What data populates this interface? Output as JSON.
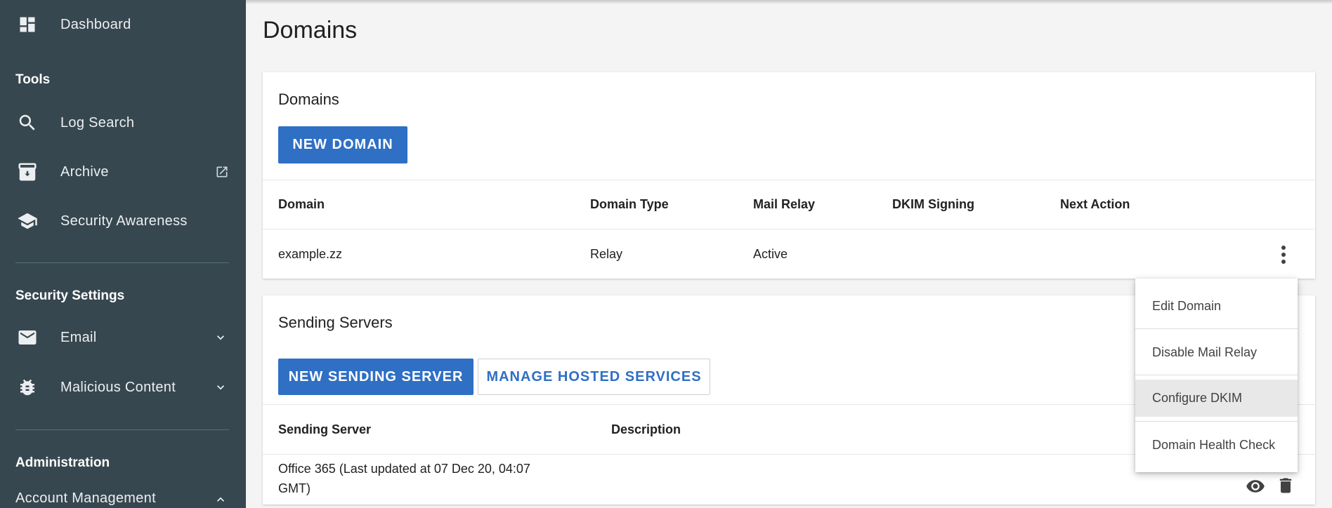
{
  "sidebar": {
    "dashboard": "Dashboard",
    "tools_title": "Tools",
    "log_search": "Log Search",
    "archive": "Archive",
    "security_awareness": "Security Awareness",
    "security_settings_title": "Security Settings",
    "email": "Email",
    "malicious_content": "Malicious Content",
    "administration_title": "Administration",
    "account_management": "Account Management"
  },
  "main": {
    "page_title": "Domains",
    "domains_card": {
      "title": "Domains",
      "new_button": "NEW DOMAIN",
      "columns": [
        "Domain",
        "Domain Type",
        "Mail Relay",
        "DKIM Signing",
        "Next Action"
      ],
      "rows": [
        {
          "domain": "example.zz",
          "type": "Relay",
          "mail_relay": "Active",
          "dkim": "",
          "next_action": ""
        }
      ]
    },
    "servers_card": {
      "title": "Sending Servers",
      "new_button": "NEW SENDING SERVER",
      "manage_button": "MANAGE HOSTED SERVICES",
      "columns": [
        "Sending Server",
        "Description"
      ],
      "rows": [
        {
          "line1": "Office 365 (Last updated at 07 Dec 20, 04:07",
          "line2": "GMT)",
          "description": ""
        }
      ]
    }
  },
  "context_menu": {
    "items": [
      "Edit Domain",
      "Disable Mail Relay",
      "Configure DKIM",
      "Domain Health Check"
    ],
    "highlighted": "Configure DKIM"
  },
  "icons": {
    "dashboard": "dashboard-icon",
    "search": "search-icon",
    "archive": "archive-icon",
    "external": "external-link-icon",
    "school": "graduation-cap-icon",
    "email": "envelope-icon",
    "bug": "bug-icon",
    "chevron_down": "chevron-down-icon",
    "chevron_up": "chevron-up-icon",
    "more": "more-vertical-icon",
    "eye": "eye-icon",
    "trash": "trash-icon"
  },
  "colors": {
    "sidebar_bg": "#37474f",
    "primary": "#2f6fc4"
  }
}
